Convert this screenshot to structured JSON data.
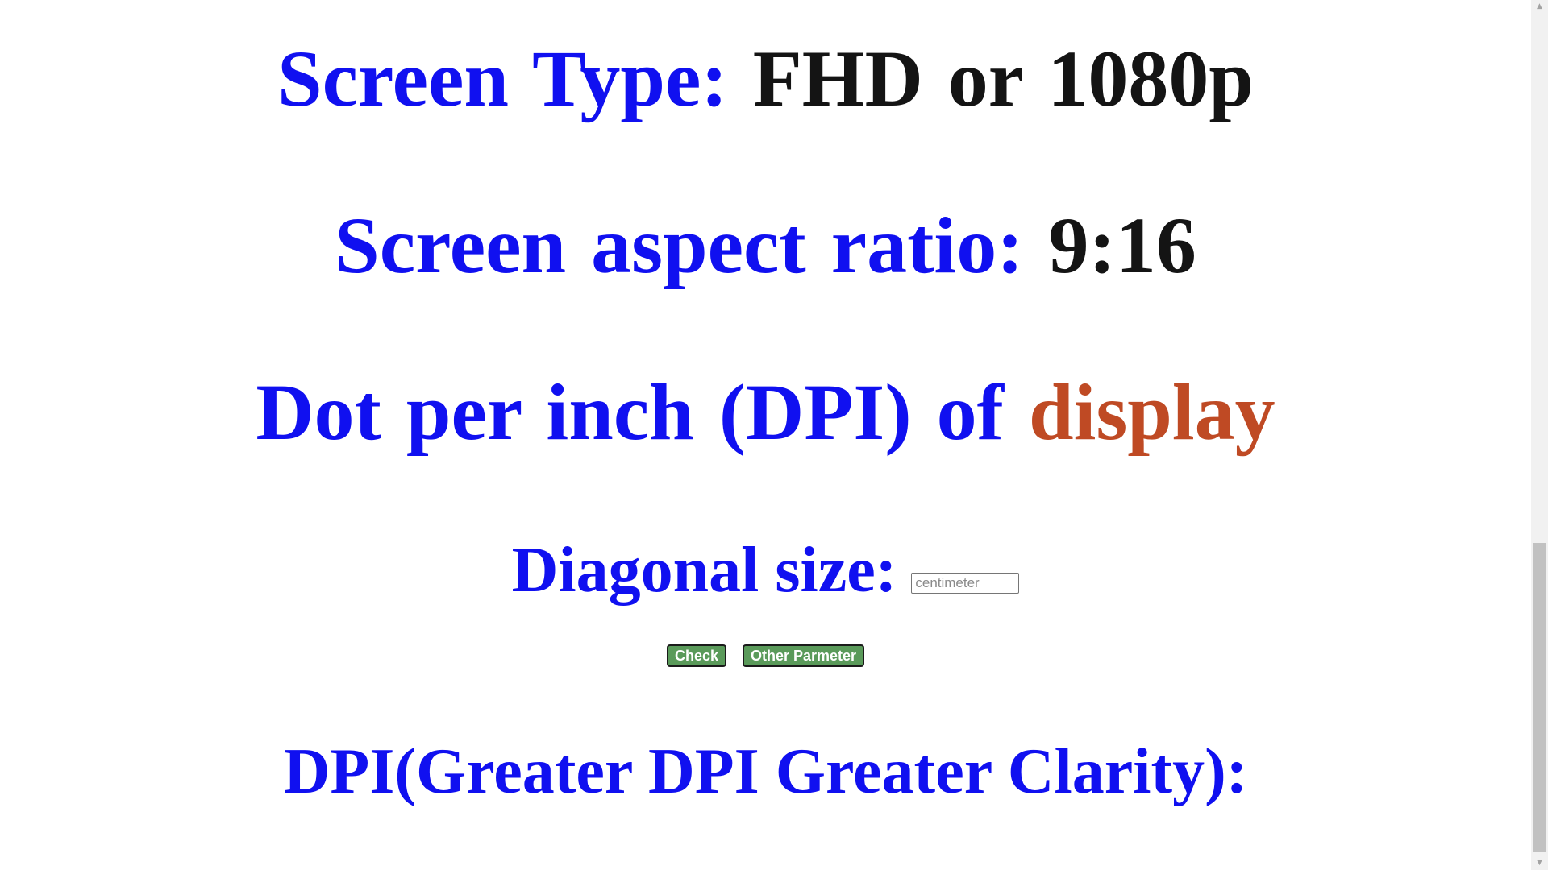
{
  "screen_type": {
    "label": "Screen Type:",
    "value": "FHD or 1080p"
  },
  "aspect_ratio": {
    "label": "Screen aspect ratio:",
    "value": "9:16"
  },
  "dpi_heading": {
    "label": "Dot per inch (DPI) of",
    "highlight": "display"
  },
  "diagonal": {
    "label": "Diagonal size:",
    "placeholder": "centimeter",
    "value": ""
  },
  "buttons": {
    "check": "Check",
    "other": "Other Parmeter"
  },
  "result": {
    "label": "DPI(Greater DPI Greater Clarity):"
  },
  "colors": {
    "label": "#1010f0",
    "value": "#141414",
    "accent": "#bf4a24",
    "button": "#5a9a5a"
  },
  "scrollbar": {
    "up_icon": "triangle-up-icon",
    "down_icon": "triangle-down-icon"
  }
}
